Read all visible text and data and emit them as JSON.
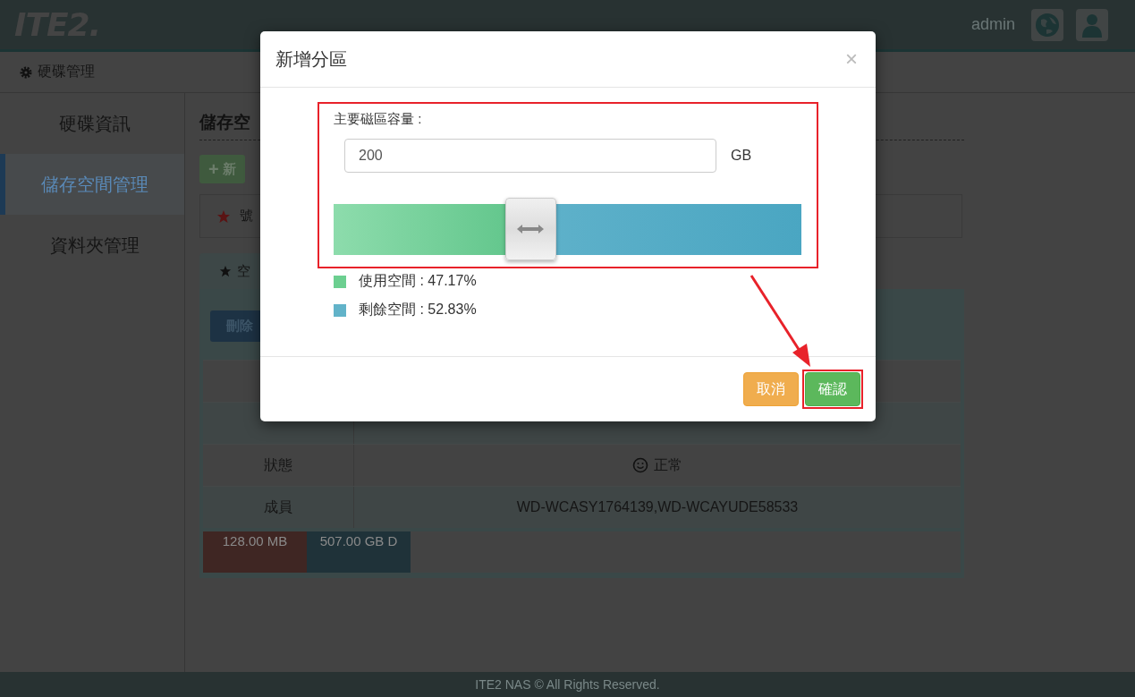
{
  "header": {
    "logo": "ITE2.",
    "user": "admin"
  },
  "breadcrumb": {
    "label": "硬碟管理"
  },
  "sidebar": {
    "items": [
      {
        "label": "硬碟資訊",
        "selected": false
      },
      {
        "label": "儲存空間管理",
        "selected": true
      },
      {
        "label": "資料夾管理",
        "selected": false
      }
    ]
  },
  "content": {
    "heading": "儲存空",
    "add_button": {
      "icon": "+",
      "label": "新"
    },
    "notice": "號",
    "panel": {
      "tab": "空",
      "delete_button": "刪除",
      "rows": [
        {
          "label": "狀態",
          "value": "正常",
          "kind": "status"
        },
        {
          "label": "成員",
          "value": "WD-WCASY1764139,WD-WCAYUDE58533",
          "kind": "text"
        }
      ],
      "segments": [
        {
          "label": "128.00 MB",
          "color": "#3f2623"
        },
        {
          "label": "507.00 GB D",
          "color": "#1f3239"
        }
      ]
    }
  },
  "footer": "ITE2 NAS © All Rights Reserved.",
  "dialog": {
    "title": "新增分區",
    "close": "×",
    "capacity": {
      "label": "主要磁區容量 :",
      "value": "200",
      "unit": "GB",
      "level": 0.42,
      "highlighted": true
    },
    "legend": [
      {
        "label": "使用空間 : 47.17%",
        "color": "#6ccf90"
      },
      {
        "label": "剩餘空間 : 52.83%",
        "color": "#62b3c9"
      }
    ],
    "buttons": [
      {
        "label": "取消",
        "kind": "cancel",
        "highlighted": false
      },
      {
        "label": "確認",
        "kind": "confirm",
        "highlighted": true
      }
    ],
    "arrow": true
  }
}
